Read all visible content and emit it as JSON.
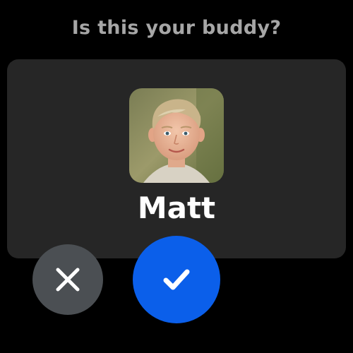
{
  "prompt": {
    "title": "Is this your buddy?"
  },
  "buddy": {
    "name": "Matt",
    "avatar": "child-portrait-photo"
  },
  "actions": {
    "cancel_icon": "close-icon",
    "confirm_icon": "checkmark-icon"
  },
  "colors": {
    "background": "#000000",
    "card": "#262626",
    "title_text": "#a6a6a6",
    "name_text": "#ffffff",
    "cancel_button": "#4b4f53",
    "confirm_button": "#0b5fea"
  }
}
